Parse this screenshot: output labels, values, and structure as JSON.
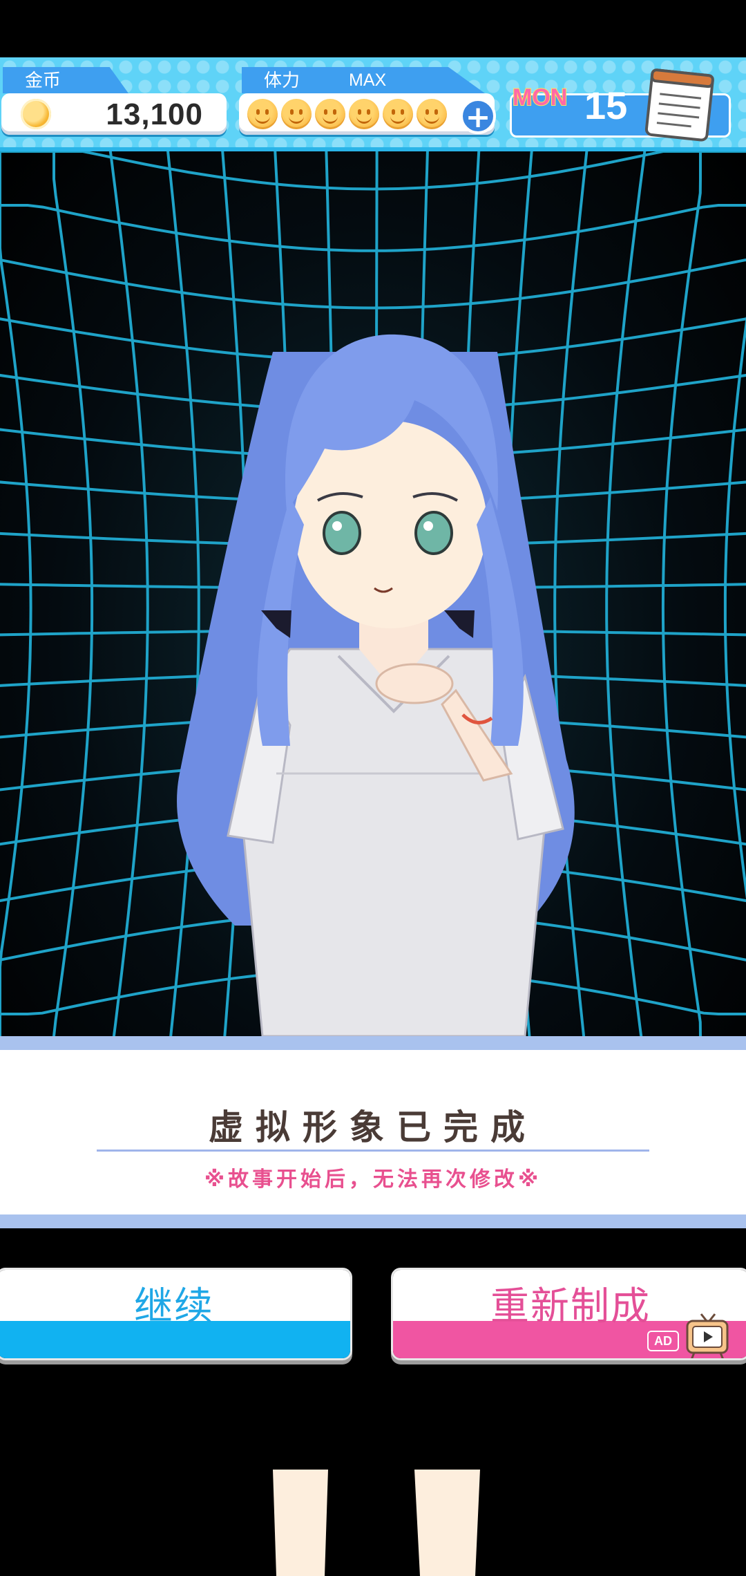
{
  "hud": {
    "coin_label": "金币",
    "coin_value": "13,100",
    "stamina_label": "体力",
    "stamina_status": "MAX",
    "stamina_count": 6,
    "day_name": "MON",
    "day_number": "15"
  },
  "message": {
    "title": "虚拟形象已完成",
    "note": "※故事开始后，无法再次修改※"
  },
  "buttons": {
    "continue_label": "继续",
    "remake_label": "重新制成",
    "ad_badge": "AD"
  },
  "colors": {
    "hud_bg": "#5fd3f7",
    "continue_accent": "#11b2f1",
    "remake_accent": "#f055a2",
    "grid_line": "#1fa3c8",
    "hair": "#7f9cec"
  }
}
